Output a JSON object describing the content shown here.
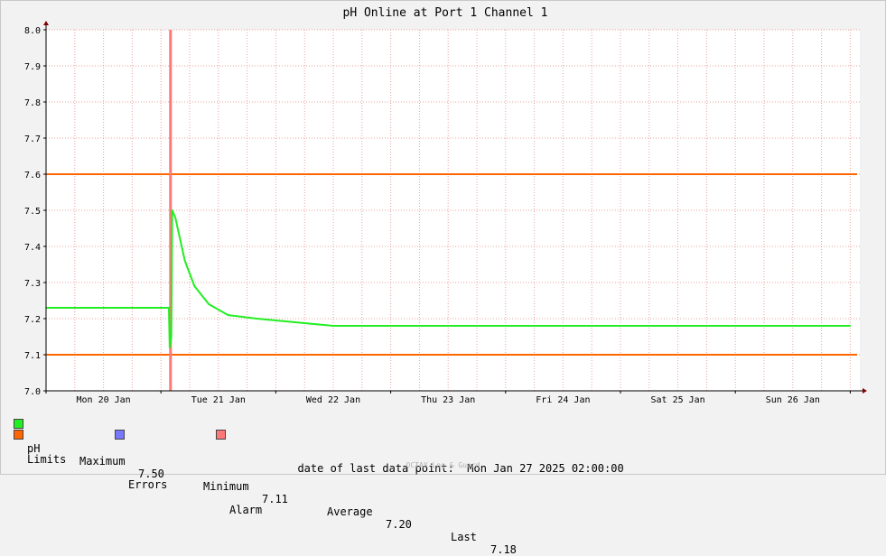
{
  "chart_data": {
    "type": "line",
    "title": "pH Online at Port 1 Channel 1",
    "ylim": [
      7.0,
      8.0
    ],
    "y_ticks": [
      "7.0",
      "7.1",
      "7.2",
      "7.3",
      "7.4",
      "7.5",
      "7.6",
      "7.7",
      "7.8",
      "7.9",
      "8.0"
    ],
    "xlim": [
      "2025-01-20T00:00",
      "2025-01-27T02:00"
    ],
    "x_tick_labels": [
      "Mon 20 Jan",
      "Tue 21 Jan",
      "Wed 22 Jan",
      "Thu 23 Jan",
      "Fri 24 Jan",
      "Sat 25 Jan",
      "Sun 26 Jan"
    ],
    "grid": true,
    "limits": {
      "upper": 7.6,
      "lower": 7.1,
      "color": "#ff6600"
    },
    "alarm": {
      "x": "2025-01-21T02:00",
      "color": "#ff7777"
    },
    "series": [
      {
        "name": "pH",
        "color": "#22ee22",
        "points": [
          [
            "2025-01-20T00:00",
            7.23
          ],
          [
            "2025-01-20T12:00",
            7.23
          ],
          [
            "2025-01-21T00:00",
            7.23
          ],
          [
            "2025-01-21T01:40",
            7.23
          ],
          [
            "2025-01-21T01:50",
            7.12
          ],
          [
            "2025-01-21T02:10",
            7.15
          ],
          [
            "2025-01-21T02:20",
            7.5
          ],
          [
            "2025-01-21T03:00",
            7.48
          ],
          [
            "2025-01-21T05:00",
            7.36
          ],
          [
            "2025-01-21T07:00",
            7.29
          ],
          [
            "2025-01-21T10:00",
            7.24
          ],
          [
            "2025-01-21T14:00",
            7.21
          ],
          [
            "2025-01-21T20:00",
            7.2
          ],
          [
            "2025-01-22T04:00",
            7.19
          ],
          [
            "2025-01-22T12:00",
            7.18
          ],
          [
            "2025-01-23T00:00",
            7.18
          ],
          [
            "2025-01-24T00:00",
            7.18
          ],
          [
            "2025-01-25T00:00",
            7.18
          ],
          [
            "2025-01-26T00:00",
            7.18
          ],
          [
            "2025-01-27T00:00",
            7.18
          ]
        ]
      }
    ]
  },
  "legend": {
    "ph_label": "pH",
    "max_label": "Maximum",
    "max_value": "7.50",
    "min_label": "Minimum",
    "min_value": "7.11",
    "avg_label": "Average",
    "avg_value": "7.20",
    "last_label": "Last",
    "last_value": "7.18",
    "limits_label": "Limits",
    "errors_label": "Errors",
    "alarm_label": "Alarm",
    "colors": {
      "ph": "#22ee22",
      "limits": "#ff6600",
      "errors": "#7777ff",
      "alarm": "#ff7777"
    }
  },
  "footer": {
    "last_point_label": "date of last data point:",
    "last_point_value": "Mon Jan 27 2025 02:00:00",
    "credit": "OCTAX Log & Guard"
  }
}
